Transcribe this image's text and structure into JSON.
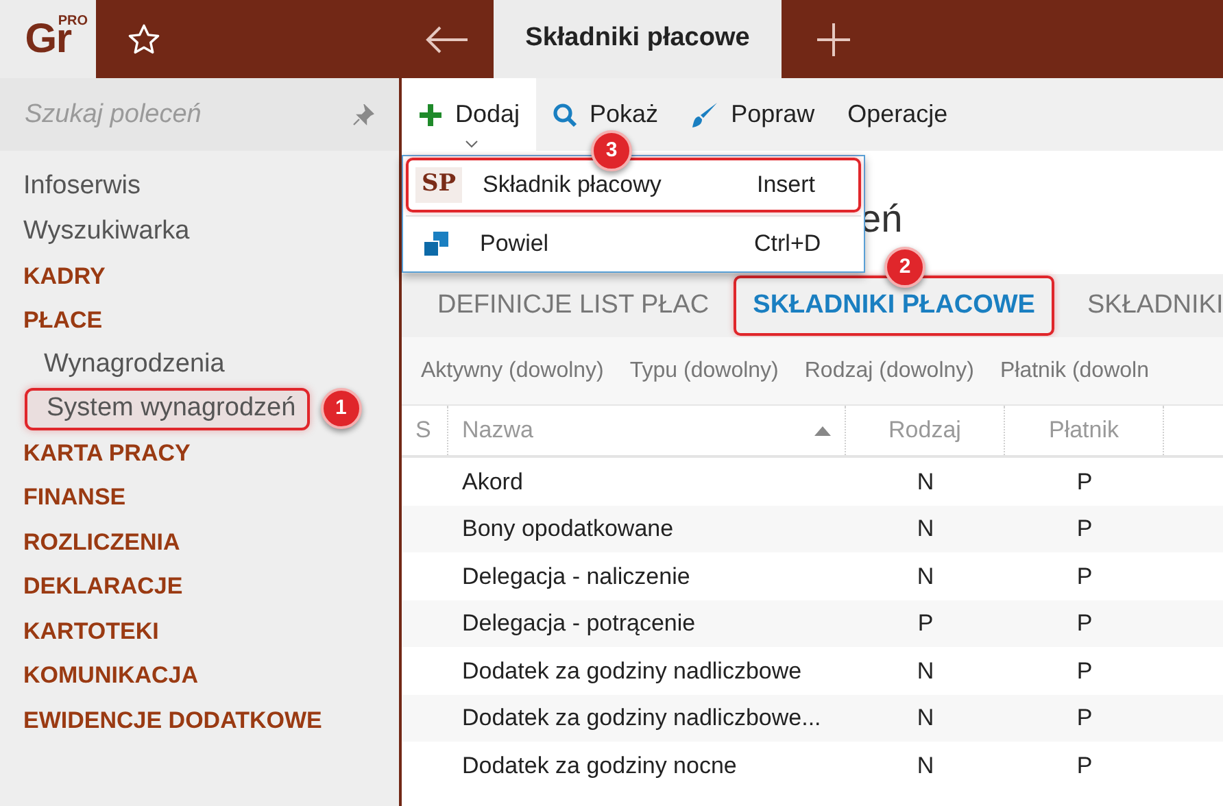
{
  "logo": {
    "text": "Gr",
    "badge": "PRO"
  },
  "window_tabs": [
    {
      "label": "Składniki płacowe",
      "selected": true
    }
  ],
  "search": {
    "placeholder": "Szukaj poleceń"
  },
  "sidebar": {
    "items": [
      {
        "label": "Infoserwis",
        "kind": "link"
      },
      {
        "label": "Wyszukiwarka",
        "kind": "link"
      },
      {
        "label": "KADRY",
        "kind": "section"
      },
      {
        "label": "PŁACE",
        "kind": "section",
        "children": [
          {
            "label": "Wynagrodzenia",
            "selected": false
          },
          {
            "label": "System wynagrodzeń",
            "selected": true
          }
        ]
      },
      {
        "label": "KARTA PRACY",
        "kind": "section"
      },
      {
        "label": "FINANSE",
        "kind": "section"
      },
      {
        "label": "ROZLICZENIA",
        "kind": "section"
      },
      {
        "label": "DEKLARACJE",
        "kind": "section"
      },
      {
        "label": "KARTOTEKI",
        "kind": "section"
      },
      {
        "label": "KOMUNIKACJA",
        "kind": "section"
      },
      {
        "label": "EWIDENCJE DODATKOWE",
        "kind": "section"
      }
    ]
  },
  "toolbar": [
    {
      "label": "Dodaj",
      "kind": "add",
      "expanded": true
    },
    {
      "label": "Pokaż",
      "kind": "show",
      "expanded": false
    },
    {
      "label": "Popraw",
      "kind": "edit",
      "expanded": false
    },
    {
      "label": "Operacje",
      "kind": "plain",
      "expanded": false
    }
  ],
  "menu": [
    {
      "icon_text": "SP",
      "label": "Składnik płacowy",
      "shortcut": "Insert",
      "kind": "text-icon",
      "highlighted": true
    },
    {
      "label": "Powiel",
      "shortcut": "Ctrl+D",
      "kind": "copy",
      "highlighted": false
    }
  ],
  "heading": "eń",
  "tabs": [
    {
      "label": "DEFINICJE LIST PŁAC",
      "selected": false
    },
    {
      "label": "SKŁADNIKI PŁACOWE",
      "selected": true
    },
    {
      "label": "SKŁADNIKI",
      "selected": false
    }
  ],
  "filters": [
    "Aktywny (dowolny)",
    "Typu (dowolny)",
    "Rodzaj (dowolny)",
    "Płatnik (dowoln"
  ],
  "table": {
    "columns": [
      {
        "label": "S",
        "sorted": false
      },
      {
        "label": "Nazwa",
        "sorted": true
      },
      {
        "label": "Rodzaj",
        "sorted": false
      },
      {
        "label": "Płatnik",
        "sorted": false
      }
    ],
    "rows": [
      [
        "",
        "Akord",
        "N",
        "P"
      ],
      [
        "",
        "Bony opodatkowane",
        "N",
        "P"
      ],
      [
        "",
        "Delegacja - naliczenie",
        "N",
        "P"
      ],
      [
        "",
        "Delegacja - potrącenie",
        "P",
        "P"
      ],
      [
        "",
        "Dodatek za godziny nadliczbowe",
        "N",
        "P"
      ],
      [
        "",
        "Dodatek za godziny nadliczbowe...",
        "N",
        "P"
      ],
      [
        "",
        "Dodatek za godziny nocne",
        "N",
        "P"
      ]
    ]
  },
  "callouts": [
    "1",
    "2",
    "3"
  ]
}
